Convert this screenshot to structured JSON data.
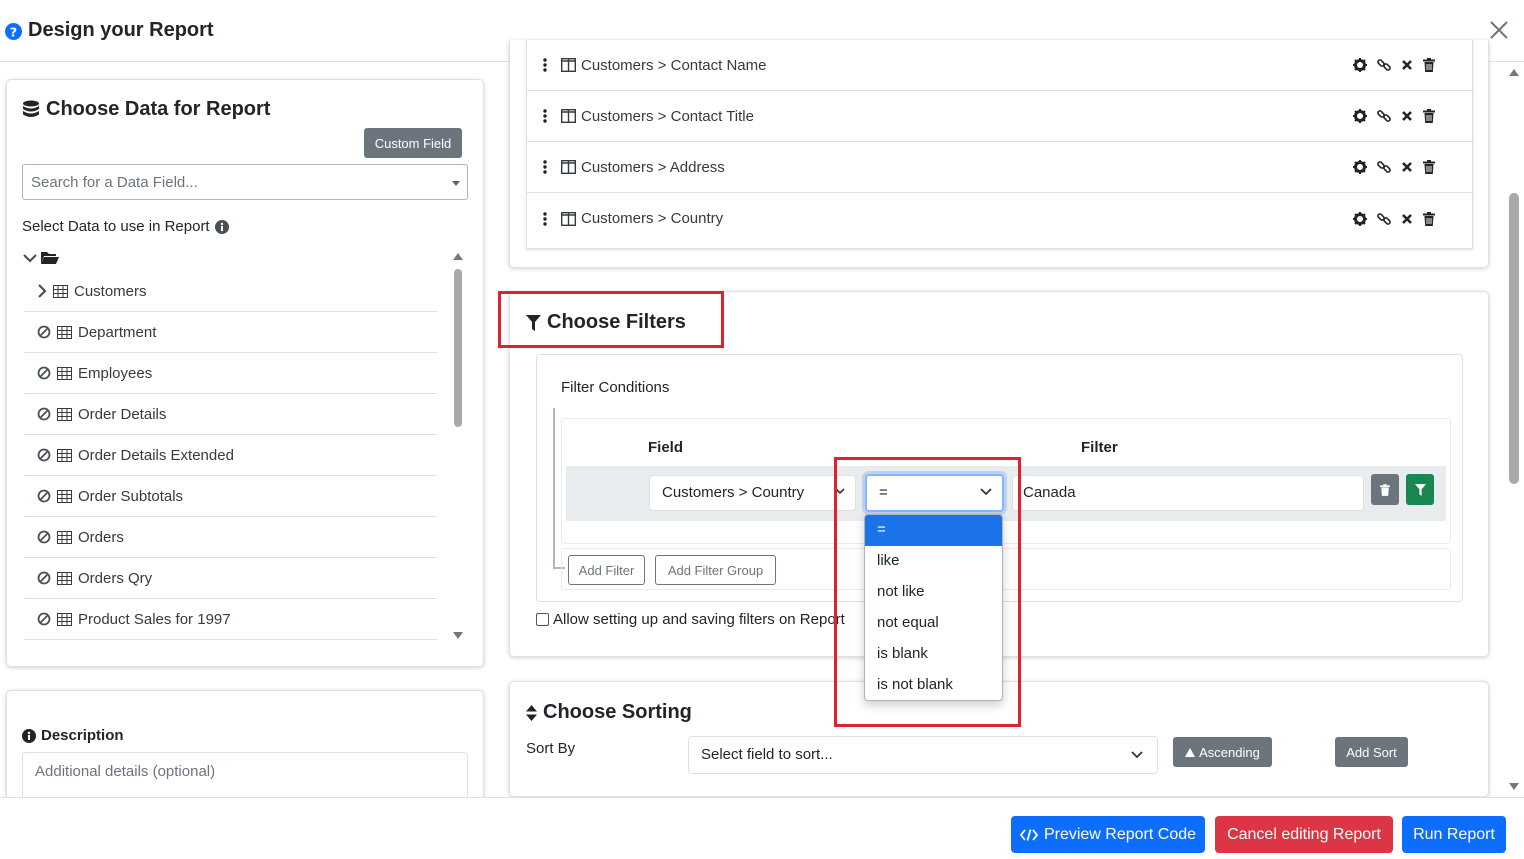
{
  "header": {
    "title": "Design your Report"
  },
  "left": {
    "title": "Choose Data for Report",
    "custom_field_label": "Custom Field",
    "search_placeholder": "Search for a Data Field...",
    "select_label": "Select Data to use in Report",
    "tree_items": [
      {
        "label": "Customers",
        "expandable": true
      },
      {
        "label": "Department"
      },
      {
        "label": "Employees"
      },
      {
        "label": "Order Details"
      },
      {
        "label": "Order Details Extended"
      },
      {
        "label": "Order Subtotals"
      },
      {
        "label": "Orders"
      },
      {
        "label": "Orders Qry"
      },
      {
        "label": "Product Sales for 1997"
      }
    ]
  },
  "description": {
    "title": "Description",
    "placeholder": "Additional details (optional)"
  },
  "selected_fields": [
    {
      "label": "Customers > Contact Name"
    },
    {
      "label": "Customers > Contact Title"
    },
    {
      "label": "Customers > Address"
    },
    {
      "label": "Customers > Country"
    }
  ],
  "filters": {
    "title": "Choose Filters",
    "conditions_label": "Filter Conditions",
    "col_field": "Field",
    "col_filter": "Filter",
    "field_value": "Customers > Country",
    "operator_value": "=",
    "filter_value": "Canada",
    "add_filter_label": "Add Filter",
    "add_filter_group_label": "Add Filter Group",
    "allow_label": "Allow setting up and saving filters on Report",
    "operator_options": [
      "=",
      "like",
      "not like",
      "not equal",
      "is blank",
      "is not blank"
    ]
  },
  "sorting": {
    "title": "Choose Sorting",
    "sort_by_label": "Sort By",
    "select_placeholder": "Select field to sort...",
    "ascending_label": "Ascending",
    "add_sort_label": "Add Sort"
  },
  "footer": {
    "preview_label": "Preview Report Code",
    "cancel_label": "Cancel editing Report",
    "run_label": "Run Report"
  },
  "colors": {
    "primary": "#0d6efd",
    "danger": "#dc3545",
    "secondary": "#6c757d",
    "success": "#198754",
    "highlight": "#e0212e"
  }
}
